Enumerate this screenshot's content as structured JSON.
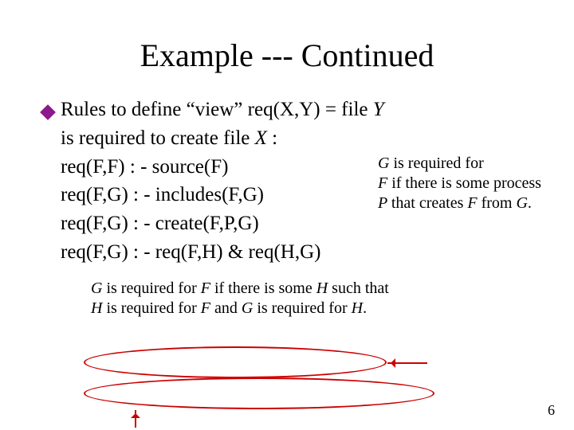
{
  "title": "Example --- Continued",
  "bullet": {
    "lead1": "Rules to define “view” req(X,Y) = file ",
    "lead_Y": "Y",
    "lead2": "is required to create file ",
    "lead_X": "X",
    "lead_colon": " :"
  },
  "rules": {
    "r1": "req(F,F) : - source(F)",
    "r2": "req(F,G) : - includes(F,G)",
    "r3": "req(F,G) : - create(F,P,G)",
    "r4": "req(F,G) : - req(F,H) & req(H,G)"
  },
  "side_note": {
    "p1a": "G",
    "p1b": " is required for ",
    "p2a": "F ",
    "p2b": " if there is some process ",
    "p2c": "P ",
    "p2d": " that creates ",
    "p2e": "F ",
    "p2f": " from ",
    "p2g": "G",
    "p2h": "."
  },
  "bottom_note": {
    "a": "G ",
    "b": " is required for ",
    "c": "F ",
    "d": " if there is some ",
    "e": "H",
    "f": " such that ",
    "g": "H ",
    "h": " is required for ",
    "i": "F ",
    "j": " and ",
    "k": "G ",
    "l": " is required for ",
    "m": "H",
    "n": "."
  },
  "page_number": "6"
}
